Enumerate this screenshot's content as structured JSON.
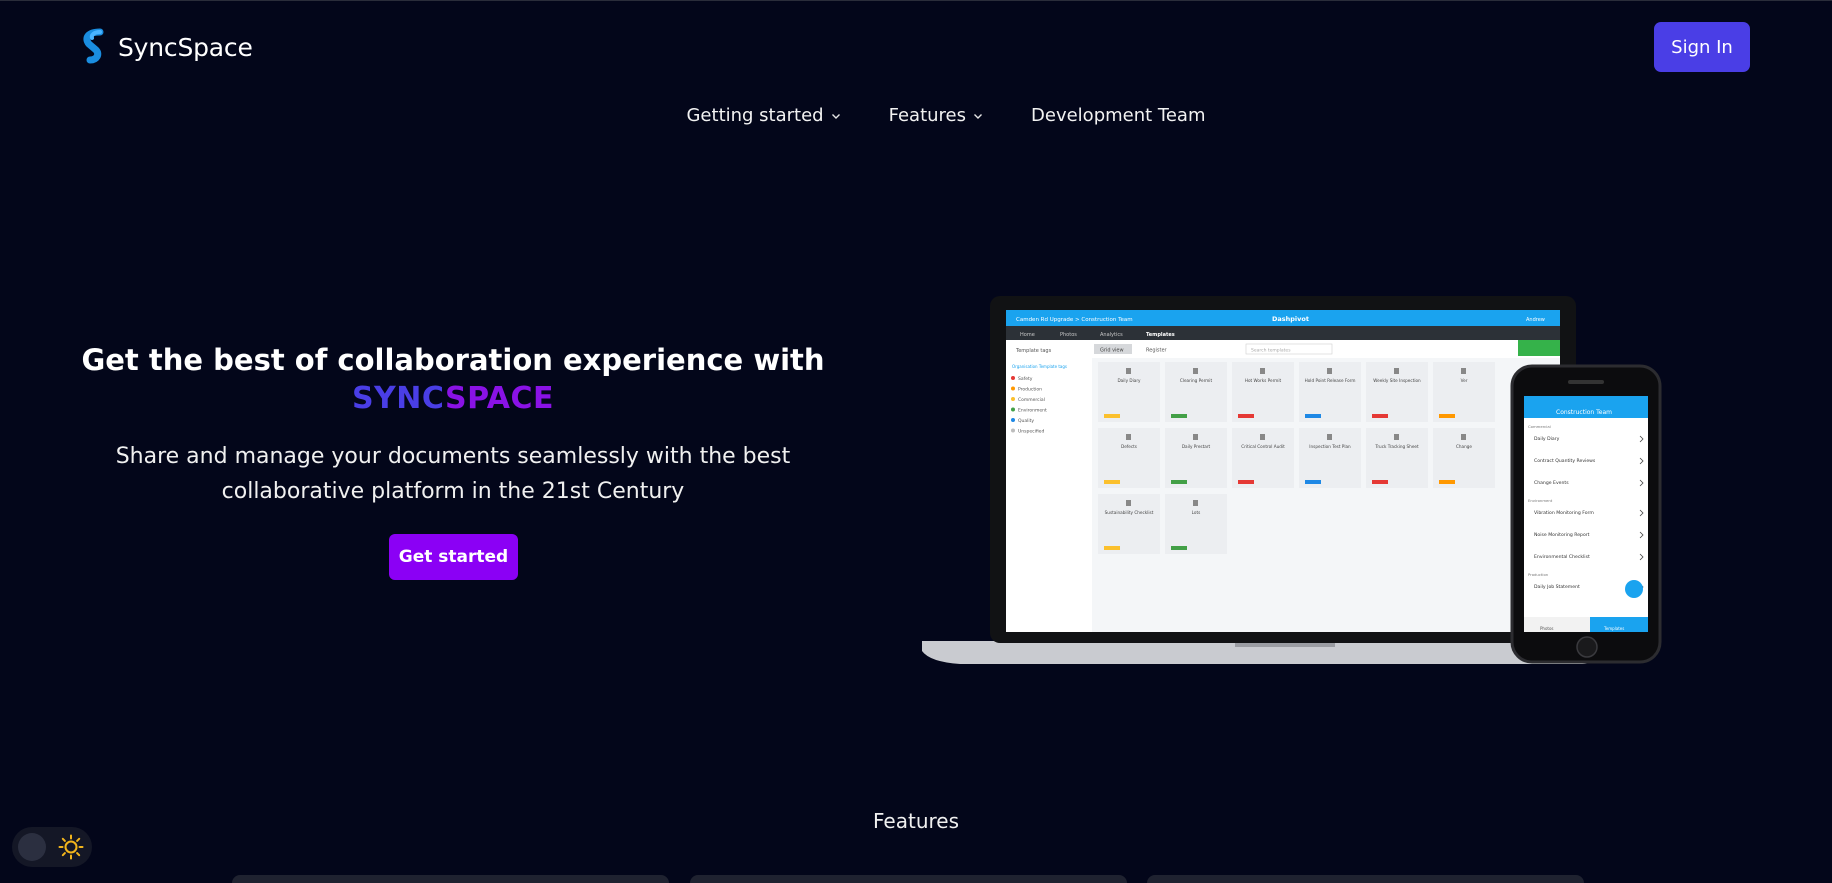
{
  "header": {
    "logo_text": "SyncSpace",
    "signin_label": "Sign In"
  },
  "nav": {
    "items": [
      {
        "label": "Getting started",
        "has_dropdown": true
      },
      {
        "label": "Features",
        "has_dropdown": true
      },
      {
        "label": "Development Team",
        "has_dropdown": false
      }
    ]
  },
  "hero": {
    "title": "Get the best of collaboration experience with",
    "brand_part1": "SYNC",
    "brand_part2": "SPACE",
    "subtitle": "Share and manage your documents seamlessly with the best collaborative platform in the 21st Century",
    "cta_label": "Get started"
  },
  "mockup": {
    "app_bar_left": "Camden Rd Upgrade > Construction Team",
    "app_bar_center": "Dashpivot",
    "app_bar_user": "Andrew",
    "tabs": [
      "Home",
      "Photos",
      "Analytics",
      "Templates"
    ],
    "toolbar": {
      "left": "Template tags",
      "grid": "Grid view",
      "register": "Register",
      "search": "Search templates"
    },
    "tags": [
      "Organisation Template tags",
      "Safety",
      "Production",
      "Commercial",
      "Environment",
      "Quality",
      "Unspecified"
    ],
    "cards_row1": [
      "Daily Diary",
      "Clearing Permit",
      "Hot Works Permit",
      "Hold Point Release Form",
      "Weekly Site Inspection",
      "Ver"
    ],
    "cards_row2": [
      "Defects",
      "Daily Prestart",
      "Critical Control Audit",
      "Inspection Test Plan",
      "Truck Tracking Sheet",
      "Change"
    ],
    "cards_row3": [
      "Sustainability Checklist",
      "Lots"
    ],
    "phone_title": "Construction Team",
    "phone_sections": [
      "Commercial",
      "Environment",
      "Production"
    ],
    "phone_items": [
      "Daily Diary",
      "Contract Quantity Reviews",
      "Change Events",
      "Vibration Monitoring Form",
      "Noise Monitoring Report",
      "Environmental Checklist",
      "Daily Job Statement"
    ],
    "phone_nav": [
      "Photos",
      "Templates"
    ]
  },
  "sections": {
    "features_heading": "Features"
  },
  "theme": {
    "background": "#03061a",
    "accent": "#4a3ee6",
    "brand_purple": "#8a12e6",
    "cta": "#8b00f5"
  }
}
